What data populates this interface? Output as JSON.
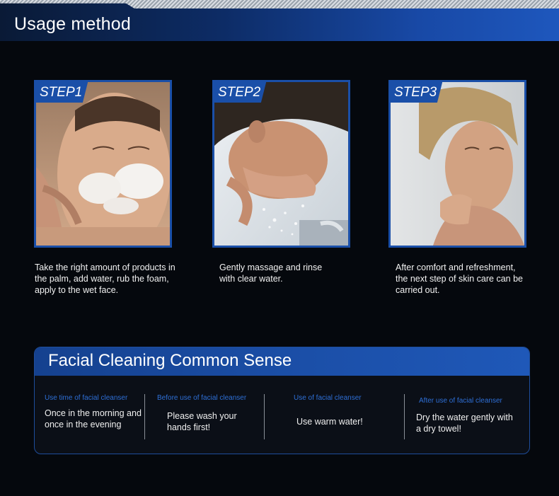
{
  "header": {
    "title": "Usage method"
  },
  "steps": [
    {
      "label": "STEP1",
      "text": "Take the right amount of products in the palm, add water, rub the foam, apply to the wet face."
    },
    {
      "label": "STEP2",
      "text": "Gently massage and rinse with clear water."
    },
    {
      "label": "STEP3",
      "text": "After comfort and refreshment, the next step of skin care can be carried out."
    }
  ],
  "sense": {
    "title": "Facial Cleaning Common Sense",
    "columns": [
      {
        "head": "Use time of facial cleanser",
        "body": "Once in the morning and once in the evening"
      },
      {
        "head": "Before use of facial cleanser",
        "body": "Please wash your hands first!"
      },
      {
        "head": "Use of facial cleanser",
        "body": "Use warm water!"
      },
      {
        "head": "After use of facial cleanser",
        "body": "Dry the water gently with a dry towel!"
      }
    ]
  },
  "colors": {
    "accent": "#1a4fa8",
    "head_text": "#2e6fd6",
    "background": "#05080d"
  }
}
